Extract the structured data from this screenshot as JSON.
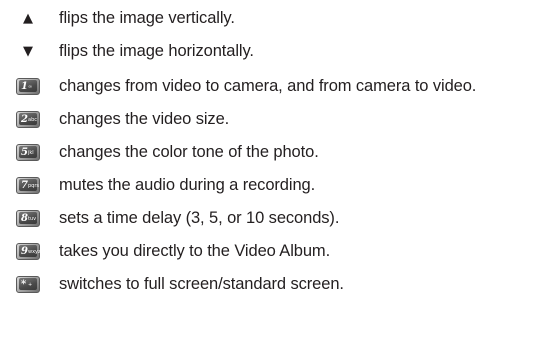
{
  "items": [
    {
      "icon": "up-arrow-icon",
      "glyph": "▲",
      "text": "flips the image vertically."
    },
    {
      "icon": "down-arrow-icon",
      "glyph": "▼",
      "text": "flips the image horizontally."
    },
    {
      "icon": "key-1-icon",
      "digit": "1",
      "letters": "∞",
      "text": "changes from video to camera, and from camera to video."
    },
    {
      "icon": "key-2-icon",
      "digit": "2",
      "letters": "abc",
      "text": "changes the video size."
    },
    {
      "icon": "key-5-icon",
      "digit": "5",
      "letters": "jkl",
      "text": "changes the color tone of the photo."
    },
    {
      "icon": "key-7-icon",
      "digit": "7",
      "letters": "pqrs",
      "text": "mutes the audio during a recording."
    },
    {
      "icon": "key-8-icon",
      "digit": "8",
      "letters": "tuv",
      "text": "sets a time delay (3, 5, or 10 seconds)."
    },
    {
      "icon": "key-9-icon",
      "digit": "9",
      "letters": "wxyz",
      "text": "takes you directly to the Video Album."
    },
    {
      "icon": "key-star-icon",
      "digit": "*",
      "letters": "+",
      "text": "switches to full screen/standard screen."
    }
  ]
}
